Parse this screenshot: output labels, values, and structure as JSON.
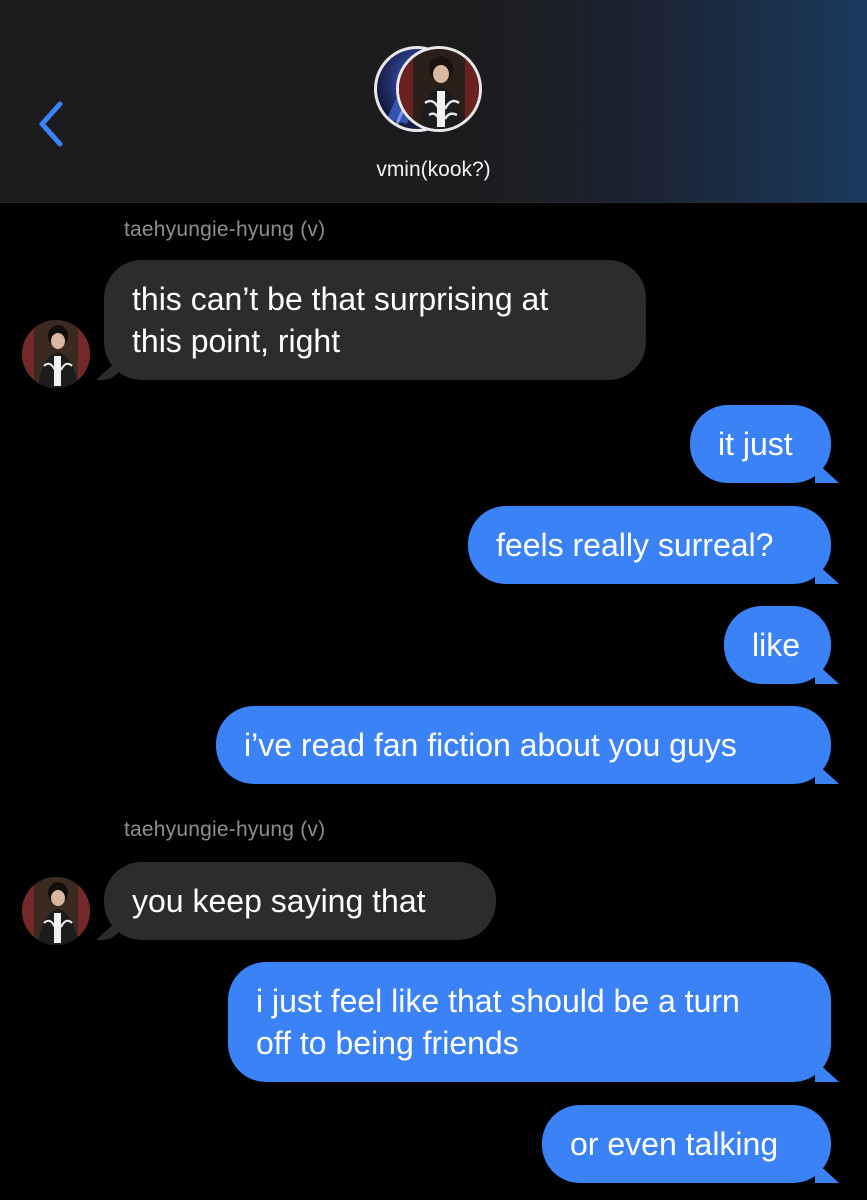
{
  "header": {
    "back_icon": "chevron-left-icon",
    "group_name": "vmin(kook?)",
    "accent": "#3a82f6"
  },
  "messages": [
    {
      "sender": "taehyungie-hyung (v)",
      "direction": "incoming",
      "lines": [
        "this can’t be that surprising at",
        "this point, right"
      ]
    },
    {
      "direction": "outgoing",
      "lines": [
        "it just"
      ]
    },
    {
      "direction": "outgoing",
      "lines": [
        "feels really surreal?"
      ]
    },
    {
      "direction": "outgoing",
      "lines": [
        "like"
      ]
    },
    {
      "direction": "outgoing",
      "lines": [
        "i’ve read fan fiction about you guys"
      ]
    },
    {
      "sender": "taehyungie-hyung (v)",
      "direction": "incoming",
      "lines": [
        "you keep saying that"
      ]
    },
    {
      "direction": "outgoing",
      "lines": [
        "i just feel like that should be a turn",
        "off to being friends"
      ]
    },
    {
      "direction": "outgoing",
      "lines": [
        "or even talking"
      ]
    }
  ],
  "colors": {
    "incoming_bubble": "#2c2c2e",
    "outgoing_bubble": "#3a82f6",
    "sender_label": "#8e8e93"
  }
}
